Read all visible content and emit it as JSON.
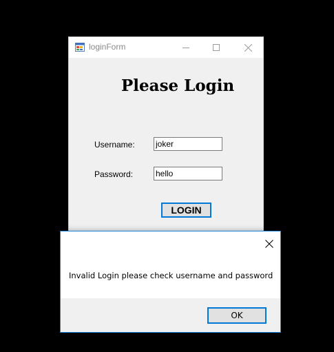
{
  "login_window": {
    "title": "loginForm",
    "app_icon": "winforms-app-icon",
    "controls": {
      "minimize_icon": "minimize-icon",
      "maximize_icon": "maximize-icon",
      "close_icon": "close-icon"
    },
    "heading": "Please Login",
    "username_label": "Username:",
    "username_value": "joker",
    "password_label": "Password:",
    "password_value": "hello",
    "login_button": "LOGIN"
  },
  "message_box": {
    "close_icon": "close-icon",
    "message": "Invalid Login please check username and password",
    "ok_button": "OK",
    "accent_color": "#0078d7"
  }
}
